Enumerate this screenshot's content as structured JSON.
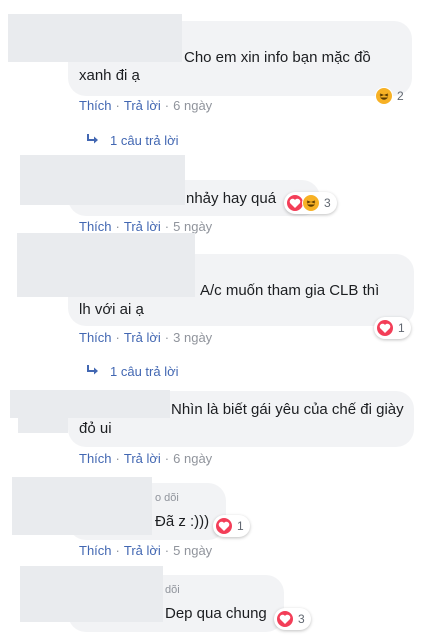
{
  "comments": [
    {
      "text_lines": [
        "Cho em xin info bạn mặc đồ",
        "xanh đi ạ"
      ],
      "actions": {
        "like": "Thích",
        "reply": "Trả lời",
        "time": "6 ngày"
      },
      "reaction": {
        "icons": [
          "haha-icon"
        ],
        "count": "2"
      },
      "replies_link": "1 câu trả lời"
    },
    {
      "text_lines": [
        "nhảy hay quá"
      ],
      "actions": {
        "like": "Thích",
        "reply": "Trả lời",
        "time": "5 ngày"
      },
      "reaction": {
        "icons": [
          "heart-icon",
          "haha-icon"
        ],
        "count": "3"
      }
    },
    {
      "text_lines": [
        "A/c muốn tham gia CLB thì",
        "lh với ai ạ"
      ],
      "actions": {
        "like": "Thích",
        "reply": "Trả lời",
        "time": "3 ngày"
      },
      "reaction": {
        "icons": [
          "heart-icon"
        ],
        "count": "1"
      },
      "replies_link": "1 câu trả lời"
    },
    {
      "text_lines": [
        "Nhìn là biết gái yêu của chế đi giày",
        "đỏ ui"
      ],
      "actions": {
        "like": "Thích",
        "reply": "Trả lời",
        "time": "6 ngày"
      }
    },
    {
      "faded_label": "o dõi",
      "text_lines": [
        "Đã z :)))"
      ],
      "actions": {
        "like": "Thích",
        "reply": "Trả lời",
        "time": "5 ngày"
      },
      "reaction": {
        "icons": [
          "heart-icon"
        ],
        "count": "1"
      }
    },
    {
      "faded_label": "dõi",
      "text_lines": [
        "Dep qua chung"
      ],
      "reaction": {
        "icons": [
          "heart-icon"
        ],
        "count": "3"
      }
    }
  ],
  "colors": {
    "bubble": "#f2f3f5",
    "link": "#4267b2",
    "meta": "#90949c",
    "heart": "#f33e58",
    "haha": "#f7b125"
  }
}
